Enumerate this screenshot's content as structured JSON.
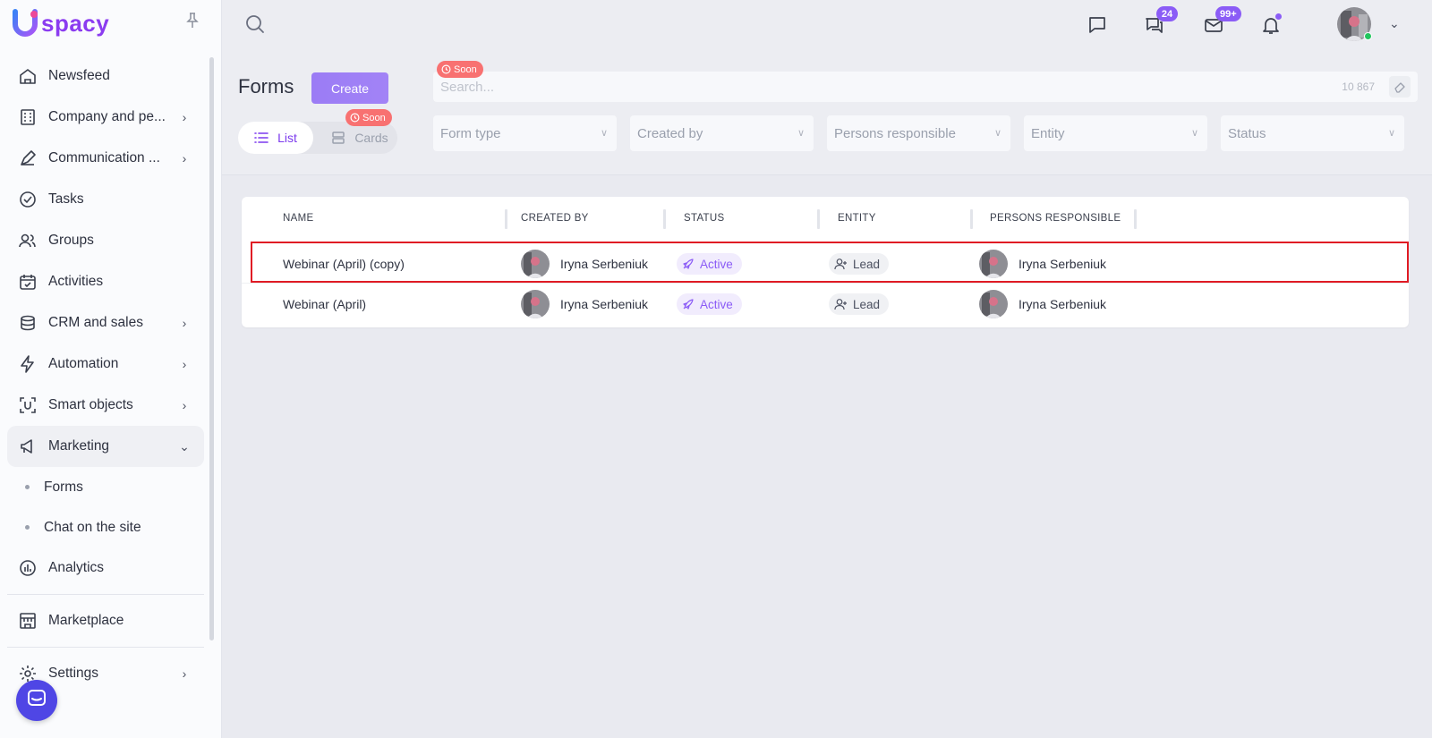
{
  "app": {
    "logo_text": "spacy",
    "logo_letter": "U"
  },
  "sidebar": {
    "items": [
      {
        "label": "Newsfeed",
        "icon": "home-icon",
        "chevron": false
      },
      {
        "label": "Company and pe...",
        "icon": "building-icon",
        "chevron": true
      },
      {
        "label": "Communication ...",
        "icon": "pen-tool-icon",
        "chevron": true
      },
      {
        "label": "Tasks",
        "icon": "check-circle-icon",
        "chevron": false
      },
      {
        "label": "Groups",
        "icon": "users-icon",
        "chevron": false
      },
      {
        "label": "Activities",
        "icon": "calendar-icon",
        "chevron": false
      },
      {
        "label": "CRM and sales",
        "icon": "coins-icon",
        "chevron": true
      },
      {
        "label": "Automation",
        "icon": "lightning-icon",
        "chevron": true
      },
      {
        "label": "Smart objects",
        "icon": "scan-icon",
        "chevron": true
      },
      {
        "label": "Marketing",
        "icon": "megaphone-icon",
        "chevron": true,
        "expanded": true
      }
    ],
    "marketing_sub": [
      {
        "label": "Forms"
      },
      {
        "label": "Chat on the site"
      }
    ],
    "analytics": {
      "label": "Analytics",
      "icon": "chart-icon"
    },
    "marketplace": {
      "label": "Marketplace",
      "icon": "store-icon"
    },
    "settings": {
      "label": "Settings",
      "icon": "gear-icon"
    }
  },
  "topbar": {
    "chat_badge": "24",
    "mail_badge": "99+"
  },
  "header": {
    "title": "Forms",
    "create_label": "Create",
    "view_list_label": "List",
    "view_cards_label": "Cards",
    "soon_label": "Soon",
    "search_placeholder": "Search...",
    "search_count": "10 867",
    "filters": [
      "Form type",
      "Created by",
      "Persons responsible",
      "Entity",
      "Status"
    ]
  },
  "table": {
    "columns": [
      "NAME",
      "CREATED BY",
      "STATUS",
      "ENTITY",
      "PERSONS RESPONSIBLE"
    ],
    "rows": [
      {
        "name": "Webinar (April) (copy)",
        "created_by": "Iryna Serbeniuk",
        "status": "Active",
        "entity": "Lead",
        "responsible": "Iryna Serbeniuk",
        "highlighted": true
      },
      {
        "name": "Webinar (April)",
        "created_by": "Iryna Serbeniuk",
        "status": "Active",
        "entity": "Lead",
        "responsible": "Iryna Serbeniuk",
        "highlighted": false
      }
    ]
  },
  "colors": {
    "accent": "#8b5cf6",
    "highlight_border": "#e01b24",
    "soon_badge": "#f87171"
  }
}
